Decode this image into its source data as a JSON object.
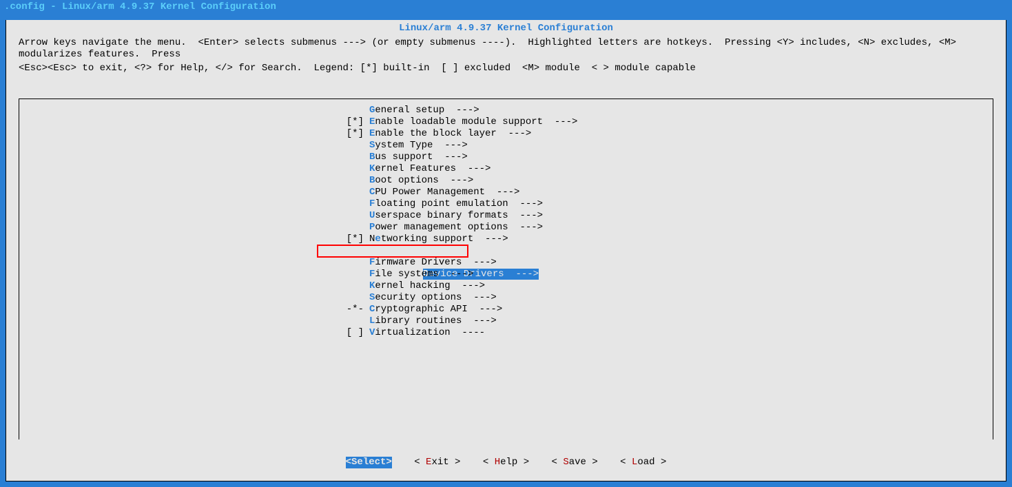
{
  "window_title": ".config - Linux/arm 4.9.37 Kernel Configuration",
  "dialog_title": "Linux/arm 4.9.37 Kernel Configuration",
  "help_line1": "Arrow keys navigate the menu.  <Enter> selects submenus ---> (or empty submenus ----).  Highlighted letters are hotkeys.  Pressing <Y> includes, <N> excludes, <M> modularizes features.  Press",
  "help_line2": "<Esc><Esc> to exit, <?> for Help, </> for Search.  Legend: [*] built-in  [ ] excluded  <M> module  < > module capable",
  "menu": [
    {
      "prefix": "",
      "hot": "G",
      "rest": "eneral setup  --->",
      "selected": false
    },
    {
      "prefix": "[*]",
      "hot": "E",
      "rest": "nable loadable module support  --->",
      "selected": false
    },
    {
      "prefix": "[*]",
      "hot": "E",
      "rest": "nable the block layer  --->",
      "selected": false
    },
    {
      "prefix": "",
      "hot": "S",
      "rest": "ystem Type  --->",
      "selected": false
    },
    {
      "prefix": "",
      "hot": "B",
      "rest": "us support  --->",
      "selected": false
    },
    {
      "prefix": "",
      "hot": "K",
      "rest": "ernel Features  --->",
      "selected": false
    },
    {
      "prefix": "",
      "hot": "B",
      "rest": "oot options  --->",
      "selected": false
    },
    {
      "prefix": "",
      "hot": "C",
      "rest": "PU Power Management  --->",
      "selected": false
    },
    {
      "prefix": "",
      "hot": "F",
      "rest": "loating point emulation  --->",
      "selected": false
    },
    {
      "prefix": "",
      "hot": "U",
      "rest": "serspace binary formats  --->",
      "selected": false
    },
    {
      "prefix": "",
      "hot": "P",
      "rest": "ower management options  --->",
      "selected": false
    },
    {
      "prefix": "[*]",
      "hot": "N",
      "rest": "etworking support  --->",
      "selected": false,
      "hotpos": 1,
      "pre": "N",
      "pretext": ""
    },
    {
      "prefix": "",
      "hot": "D",
      "rest": "evice Drivers  --->",
      "selected": true
    },
    {
      "prefix": "",
      "hot": "F",
      "rest": "irmware Drivers  --->",
      "selected": false
    },
    {
      "prefix": "",
      "hot": "F",
      "rest": "ile systems  --->",
      "selected": false
    },
    {
      "prefix": "",
      "hot": "K",
      "rest": "ernel hacking  --->",
      "selected": false
    },
    {
      "prefix": "",
      "hot": "S",
      "rest": "ecurity options  --->",
      "selected": false
    },
    {
      "prefix": "-*-",
      "hot": "C",
      "rest": "ryptographic API  --->",
      "selected": false
    },
    {
      "prefix": "",
      "hot": "L",
      "rest": "ibrary routines  --->",
      "selected": false
    },
    {
      "prefix": "[ ]",
      "hot": "V",
      "rest": "irtualization  ----",
      "selected": false
    }
  ],
  "networking_label_pre": "N",
  "networking_hot": "e",
  "networking_rest": "tworking support  --->",
  "buttons": {
    "select": "<Select>",
    "exit_pre": "< ",
    "exit_hot": "E",
    "exit_post": "xit >",
    "help_pre": "< ",
    "help_hot": "H",
    "help_post": "elp >",
    "save_pre": "< ",
    "save_hot": "S",
    "save_post": "ave >",
    "load_pre": "< ",
    "load_hot": "L",
    "load_post": "oad >"
  }
}
